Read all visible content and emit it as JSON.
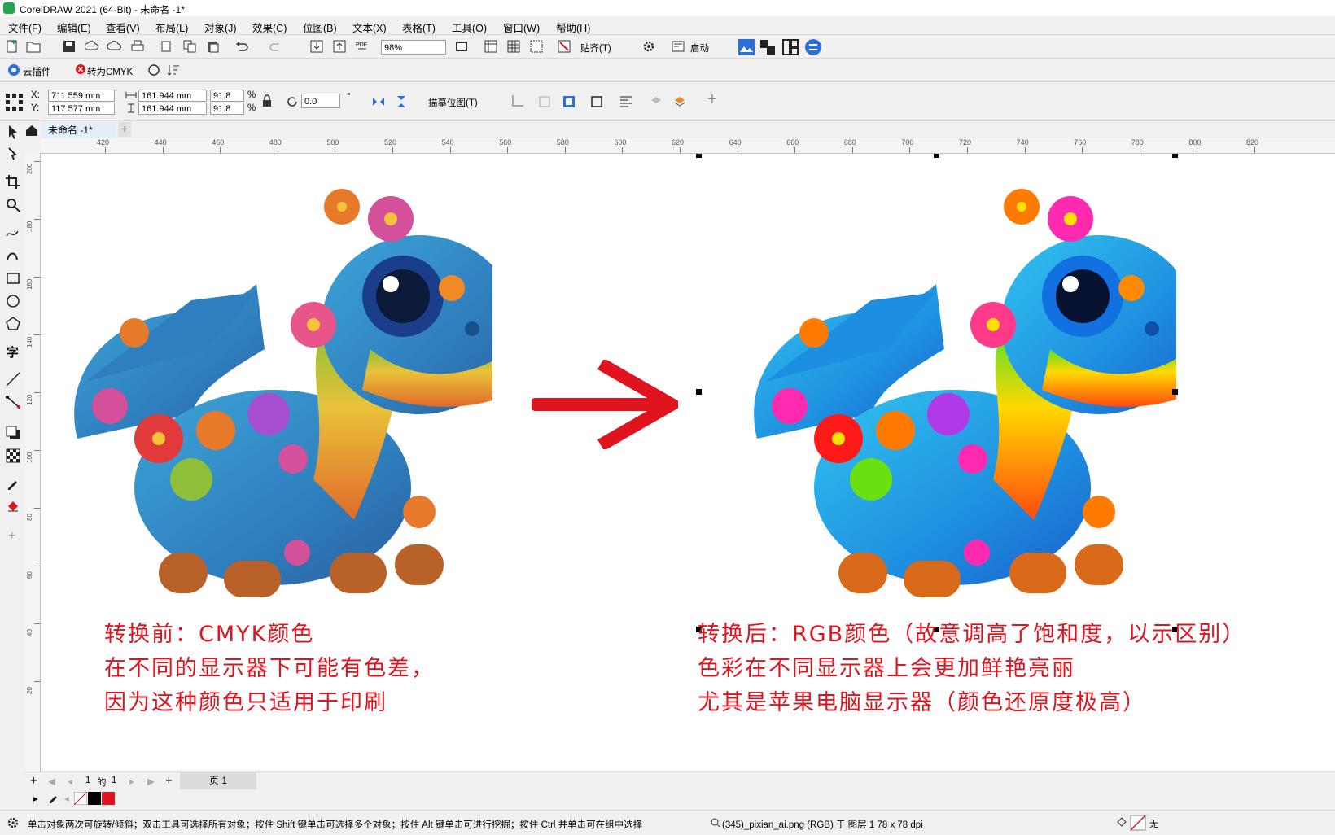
{
  "window": {
    "title": "CorelDRAW 2021 (64-Bit) - 未命名 -1*"
  },
  "menu": [
    "文件(F)",
    "编辑(E)",
    "查看(V)",
    "布局(L)",
    "对象(J)",
    "效果(C)",
    "位图(B)",
    "文本(X)",
    "表格(T)",
    "工具(O)",
    "窗口(W)",
    "帮助(H)"
  ],
  "standard_toolbar": {
    "zoom": "98%",
    "snap_label": "贴齐(T)",
    "launch_label": "启动"
  },
  "plugin_toolbar": {
    "cloud_plugin": "云插件",
    "to_cmyk": "转为CMYK"
  },
  "property_bar": {
    "x_label": "X:",
    "y_label": "Y:",
    "x": "711.559 mm",
    "y": "117.577 mm",
    "width": "161.944 mm",
    "height": "161.944 mm",
    "scale_w": "91.8",
    "scale_h": "91.8",
    "percent": "%",
    "angle": "0.0",
    "degree": "°",
    "trace_bitmap": "描摹位图(T)"
  },
  "tabs": {
    "document": "未命名 -1*",
    "add": "+"
  },
  "ruler_h": [
    "420",
    "440",
    "460",
    "480",
    "500",
    "520",
    "540",
    "560",
    "580",
    "600",
    "620",
    "640",
    "660",
    "680",
    "700",
    "720",
    "740",
    "760",
    "780",
    "800",
    "820"
  ],
  "ruler_v": [
    "200",
    "180",
    "160",
    "140",
    "120",
    "100",
    "80",
    "60",
    "40",
    "20"
  ],
  "captions": {
    "left_1": "转换前：CMYK颜色",
    "left_2": "在不同的显示器下可能有色差，",
    "left_3": "因为这种颜色只适用于印刷",
    "right_1": "转换后：RGB颜色（故意调高了饱和度，以示区别）",
    "right_2": "色彩在不同显示器上会更加鲜艳亮丽",
    "right_3": "尤其是苹果电脑显示器（颜色还原度极高）"
  },
  "page_nav": {
    "current": "1",
    "of": "的",
    "total": "1",
    "page_tab": "页 1"
  },
  "colors": {
    "accent": "#e0141e",
    "selection_blue": "#3c8fe0"
  },
  "status": {
    "hint": "单击对象两次可旋转/倾斜；双击工具可选择所有对象；按住 Shift 键单击可选择多个对象；按住 Alt 键单击可进行挖掘；按住 Ctrl 并单击可在组中选择",
    "object_info": "(345)_pixian_ai.png (RGB) 于 图层 1 78 x 78 dpi",
    "fill_none": "无"
  }
}
